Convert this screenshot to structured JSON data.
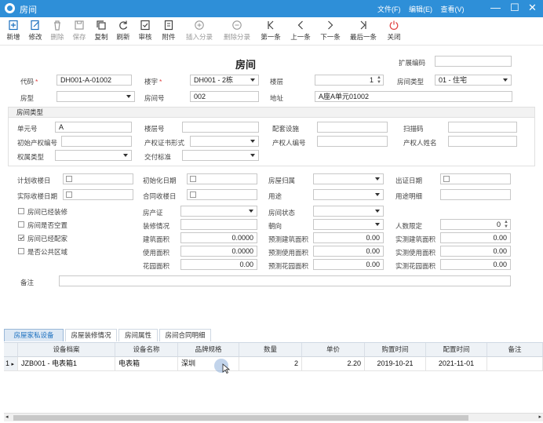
{
  "window": {
    "title": "房间",
    "menus": [
      "文件(F)",
      "编辑(E)",
      "查看(V)"
    ],
    "min": "—",
    "max": "☐",
    "close": "✕"
  },
  "toolbar": [
    {
      "label": "新增",
      "icon": "new-icon",
      "enabled": true
    },
    {
      "label": "修改",
      "icon": "edit-icon",
      "enabled": true
    },
    {
      "label": "删除",
      "icon": "delete-icon",
      "enabled": false
    },
    {
      "label": "保存",
      "icon": "save-icon",
      "enabled": false
    },
    {
      "label": "复制",
      "icon": "copy-icon",
      "enabled": true
    },
    {
      "label": "刷新",
      "icon": "refresh-icon",
      "enabled": true
    },
    {
      "label": "审核",
      "icon": "audit-icon",
      "enabled": true
    },
    {
      "label": "附件",
      "icon": "attachment-icon",
      "enabled": true
    },
    {
      "label": "插入分录",
      "icon": "plus-circle-icon",
      "enabled": false
    },
    {
      "label": "删除分录",
      "icon": "minus-circle-icon",
      "enabled": false
    },
    {
      "label": "第一条",
      "icon": "first-icon",
      "enabled": true
    },
    {
      "label": "上一条",
      "icon": "prev-icon",
      "enabled": true
    },
    {
      "label": "下一条",
      "icon": "next-icon",
      "enabled": true
    },
    {
      "label": "最后一条",
      "icon": "last-icon",
      "enabled": true
    },
    {
      "label": "关闭",
      "icon": "power-icon",
      "enabled": true
    }
  ],
  "form": {
    "title": "房间",
    "ext_code_label": "扩展编码",
    "ext_code": "",
    "code_label": "代码",
    "code": "DH001-A-01002",
    "building_label": "楼宇",
    "building": "DH001 - 2栋",
    "floor_label": "楼层",
    "floor": "1",
    "room_type_label": "房间类型",
    "room_type": "01 - 住宅",
    "layout_label": "房型",
    "layout": "",
    "room_no_label": "房间号",
    "room_no": "002",
    "address_label": "地址",
    "address": "A座A单元01002",
    "section_title": "房间类型",
    "unit_no_label": "单元号",
    "unit_no": "A",
    "floor_no_label": "楼层号",
    "floor_no": "",
    "facility_label": "配套设施",
    "facility": "",
    "scan_label": "扫描码",
    "scan": "",
    "init_cert_label": "初始产权编号",
    "init_cert": "",
    "cert_form_label": "产权证书形式",
    "cert_form": "",
    "owner_no_label": "产权人编号",
    "owner_no": "",
    "owner_name_label": "产权人姓名",
    "owner_name": "",
    "right_type_label": "权属类型",
    "right_type": "",
    "deliver_label": "交付标准",
    "deliver": "",
    "plan_recv_label": "计划收楼日",
    "init_date_label": "初始化日期",
    "ownership_label": "房屋归属",
    "cert_date_label": "出证日期",
    "actual_recv_label": "实际收楼日期",
    "contract_recv_label": "合同收楼日",
    "usage_label": "用途",
    "usage_detail_label": "用途明细",
    "cb_decorated": "房间已经装修",
    "cb_vacant": "房间是否空置",
    "cb_furnished": "房间已经配家",
    "cb_public": "是否公共区域",
    "cb_decorated_on": false,
    "cb_vacant_on": false,
    "cb_furnished_on": true,
    "cb_public_on": false,
    "house_cert_label": "房产证",
    "room_status_label": "房间状态",
    "deco_label": "装修情况",
    "orient_label": "朝向",
    "people_label": "人数限定",
    "people": "0",
    "build_area_label": "建筑面积",
    "build_area": "0.0000",
    "pre_build_label": "预测建筑面积",
    "pre_build": "0.00",
    "act_build_label": "实测建筑面积",
    "act_build": "0.00",
    "use_area_label": "使用面积",
    "use_area": "0.0000",
    "pre_use_label": "预测使用面积",
    "pre_use": "0.00",
    "act_use_label": "实测使用面积",
    "act_use": "0.00",
    "garden_label": "花园面积",
    "garden": "0.00",
    "pre_garden_label": "预测花园面积",
    "pre_garden": "0.00",
    "act_garden_label": "实测花园面积",
    "act_garden": "0.00",
    "remark_label": "备注",
    "remark": ""
  },
  "tabs": [
    "房屋家私设备",
    "房屋装修情况",
    "房间属性",
    "房间合同明细"
  ],
  "table": {
    "columns": [
      "设备档案",
      "设备名称",
      "品牌规格",
      "数量",
      "单价",
      "购置时间",
      "配置时间",
      "备注"
    ],
    "rows": [
      [
        "JZB001 - 电表箱1",
        "电表箱",
        "深圳",
        "2",
        "2.20",
        "2019-10-21",
        "2021-11-01",
        ""
      ]
    ],
    "row_no": "1"
  },
  "colors": {
    "titlebar": "#2e8fd8",
    "tab_active": "#1a6fbf"
  }
}
